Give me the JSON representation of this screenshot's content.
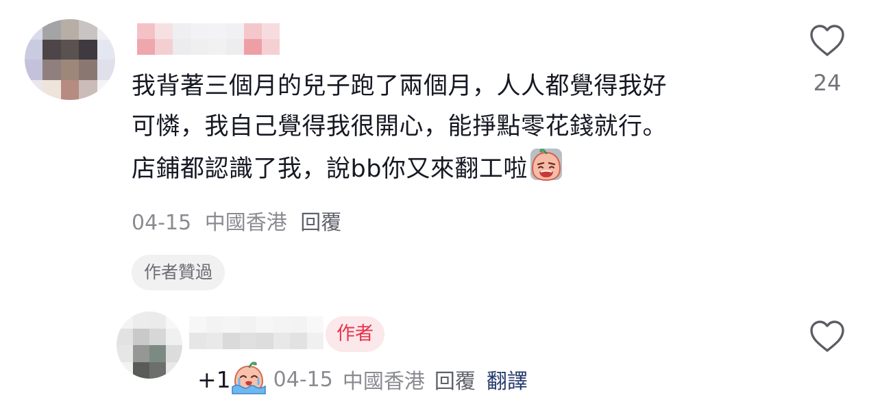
{
  "comment": {
    "lines": [
      "我背著三個月的兒子跑了兩個月，人人都覺得我好",
      "可憐，我自己覺得我很開心，能掙點零花錢就行。",
      "店鋪都認識了我，說bb你又來翻工啦"
    ],
    "emoji": "crying-face-emoji",
    "date": "04-15",
    "location": "中國香港",
    "reply_label": "回覆",
    "like_count": "24",
    "liked_by_author_label": "作者贊過"
  },
  "reply": {
    "author_badge": "作者",
    "text": "+1",
    "emoji": "crying-with-tears-emoji",
    "date": "04-15",
    "location": "中國香港",
    "reply_label": "回覆",
    "translate_label": "翻譯"
  },
  "colors": {
    "text": "#161823",
    "meta": "#8a8b91",
    "author_badge_bg": "#fbe8ea",
    "author_badge_text": "#e8334c",
    "translate": "#253b6e"
  }
}
